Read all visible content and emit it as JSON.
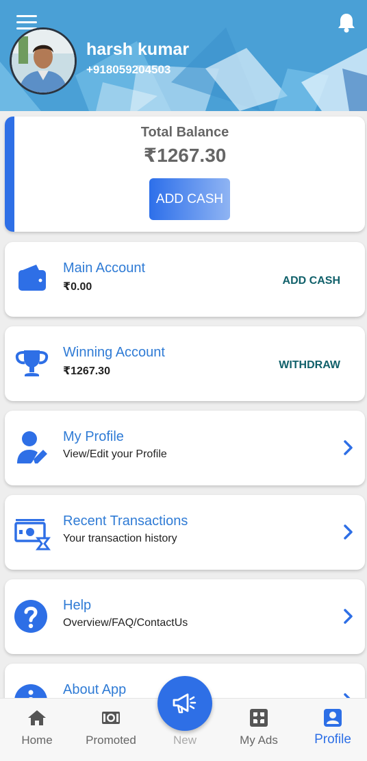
{
  "header": {
    "user_name": "harsh kumar",
    "user_phone": "+918059204503",
    "menu_icon": "hamburger-menu-icon",
    "bell_icon": "bell-icon",
    "bg_color": "#4aa0d6"
  },
  "balance": {
    "title": "Total Balance",
    "amount": "₹1267.30",
    "add_cash_label": "ADD CASH",
    "accent_color": "#2e6fe6"
  },
  "main_account": {
    "title": "Main Account",
    "amount": "₹0.00",
    "action": "ADD CASH",
    "icon": "wallet-icon"
  },
  "winning_account": {
    "title": "Winning Account",
    "amount": "₹1267.30",
    "action": "WITHDRAW",
    "icon": "trophy-icon"
  },
  "menu": [
    {
      "title": "My Profile",
      "subtitle": "View/Edit your Profile",
      "icon": "user-edit-icon"
    },
    {
      "title": "Recent Transactions",
      "subtitle": "Your transaction history",
      "icon": "money-hourglass-icon"
    },
    {
      "title": "Help",
      "subtitle": "Overview/FAQ/ContactUs",
      "icon": "question-circle-icon"
    },
    {
      "title": "About App",
      "subtitle": "",
      "icon": "info-circle-icon"
    }
  ],
  "bottom_nav": {
    "items": [
      {
        "label": "Home",
        "icon": "home-icon"
      },
      {
        "label": "Promoted",
        "icon": "promoted-icon"
      },
      {
        "label": "New",
        "icon": "megaphone-icon"
      },
      {
        "label": "My Ads",
        "icon": "my-ads-icon"
      },
      {
        "label": "Profile",
        "icon": "profile-badge-icon"
      }
    ],
    "active": "Profile",
    "active_color": "#2d6fe6"
  }
}
